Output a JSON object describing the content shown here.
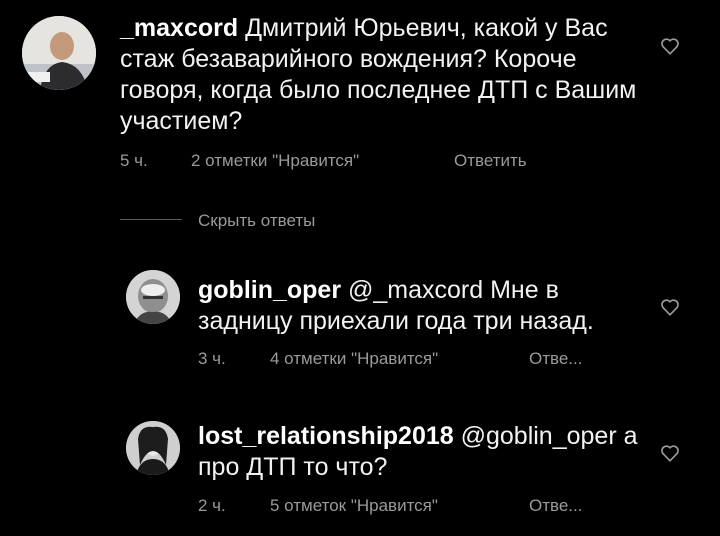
{
  "comments": [
    {
      "username": "_maxcord",
      "text": " Дмитрий Юрьевич, какой у Вас стаж безаварийного вождения? Короче говоря, когда было последнее ДТП с Вашим участием?",
      "time": "5 ч.",
      "likes": "2 отметки \"Нравится\"",
      "reply": "Ответить"
    }
  ],
  "hide_replies": "Скрыть ответы",
  "replies": [
    {
      "username": "goblin_oper",
      "text": " @_maxcord Мне в задницу приехали года три назад.",
      "time": "3 ч.",
      "likes": "4 отметки \"Нравится\"",
      "reply": "Отве..."
    },
    {
      "username": "lost_relationship2018",
      "text": " @goblin_oper а про ДТП то что?",
      "time": "2 ч.",
      "likes": "5 отметок \"Нравится\"",
      "reply": "Отве..."
    }
  ],
  "colors": {
    "background": "#000000",
    "text": "#f2f2f2",
    "meta": "#9a9a9a"
  },
  "icons": {
    "like": "heart-outline-icon"
  }
}
